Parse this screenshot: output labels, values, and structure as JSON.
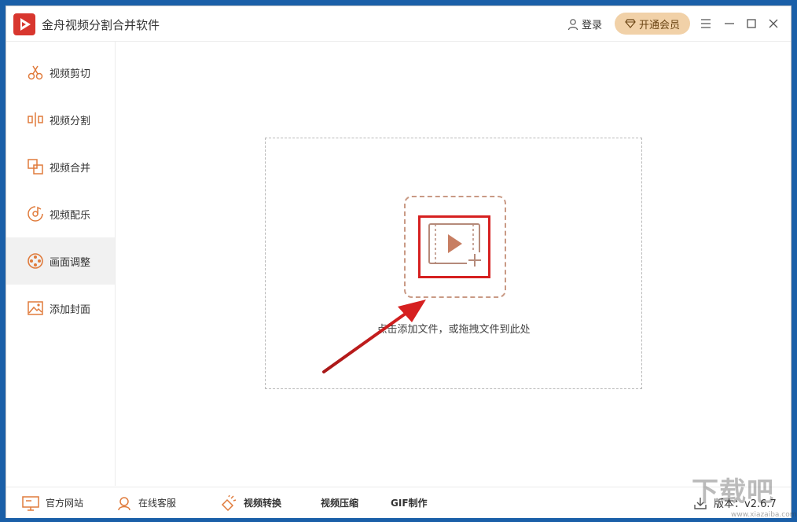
{
  "app": {
    "title": "金舟视频分割合并软件",
    "login_label": "登录",
    "vip_label": "开通会员"
  },
  "window_controls": {
    "menu_icon": "hamburger-icon",
    "minimize_icon": "minimize-icon",
    "maximize_icon": "maximize-icon",
    "close_icon": "close-icon"
  },
  "sidebar": {
    "items": [
      {
        "label": "视频剪切",
        "icon": "scissors-icon",
        "active": false
      },
      {
        "label": "视频分割",
        "icon": "split-icon",
        "active": false
      },
      {
        "label": "视频合并",
        "icon": "merge-icon",
        "active": false
      },
      {
        "label": "视频配乐",
        "icon": "music-disc-icon",
        "active": false
      },
      {
        "label": "画面调整",
        "icon": "film-reel-icon",
        "active": true
      },
      {
        "label": "添加封面",
        "icon": "image-icon",
        "active": false
      }
    ]
  },
  "main": {
    "drop_hint": "点击添加文件，或拖拽文件到此处",
    "add_icon": "add-video-icon"
  },
  "footer": {
    "official_site": "官方网站",
    "online_service": "在线客服",
    "video_convert": "视频转换",
    "video_compress": "视频压缩",
    "gif_make": "GIF制作",
    "version": "版本：v2.6.7"
  },
  "watermark": {
    "text": "下载吧",
    "sub": "www.xiazaiba.com"
  },
  "colors": {
    "accent": "#e07b3c",
    "vip_bg": "#f1d1a8",
    "logo_red": "#d8362e",
    "highlight_red": "#d62020"
  }
}
